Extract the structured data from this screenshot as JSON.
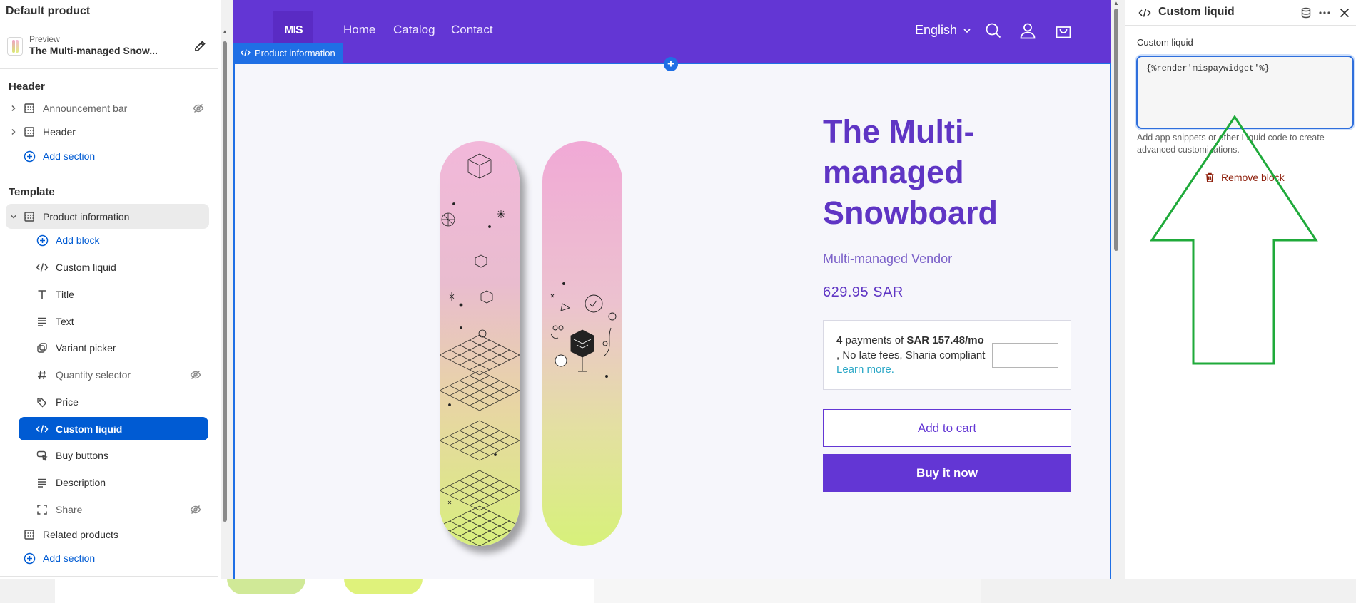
{
  "sidebar": {
    "title": "Default product",
    "preview": {
      "kicker": "Preview",
      "name": "The Multi-managed Snow..."
    },
    "header_group": {
      "heading": "Header",
      "items": [
        {
          "label": "Announcement bar",
          "hidden": true
        },
        {
          "label": "Header",
          "hidden": false
        }
      ],
      "add_section": "Add section"
    },
    "template_group": {
      "heading": "Template",
      "section": "Product information",
      "add_block": "Add block",
      "blocks": [
        {
          "label": "Custom liquid",
          "icon": "code-icon"
        },
        {
          "label": "Title",
          "icon": "text-title-icon"
        },
        {
          "label": "Text",
          "icon": "text-align-icon"
        },
        {
          "label": "Variant picker",
          "icon": "variant-icon"
        },
        {
          "label": "Quantity selector",
          "icon": "hash-icon",
          "hidden": true
        },
        {
          "label": "Price",
          "icon": "price-tag-icon"
        },
        {
          "label": "Custom liquid",
          "icon": "code-icon",
          "active": true
        },
        {
          "label": "Buy buttons",
          "icon": "cursor-icon"
        },
        {
          "label": "Description",
          "icon": "text-align-icon"
        },
        {
          "label": "Share",
          "icon": "share-icon",
          "hidden": true
        }
      ],
      "related": "Related products",
      "add_section": "Add section"
    }
  },
  "store": {
    "logo": "MIS",
    "nav": [
      "Home",
      "Catalog",
      "Contact"
    ],
    "language": "English",
    "section_tag": "Product information",
    "product": {
      "title": "The Multi-managed Snowboard",
      "vendor": "Multi-managed Vendor",
      "price": "629.95 SAR",
      "installments": {
        "count": "4",
        "payments_of": "payments of",
        "amount": "SAR 157.48/mo",
        "terms": ", No late fees, Sharia compliant",
        "link": "Learn more."
      },
      "add_to_cart": "Add to cart",
      "buy_now": "Buy it now"
    }
  },
  "panel": {
    "title": "Custom liquid",
    "field_label": "Custom liquid",
    "code": "{%render'mispaywidget'%}",
    "help": "Add app snippets or other Liquid code to create advanced customizations.",
    "remove": "Remove block"
  },
  "colors": {
    "brand_purple": "#6336d4",
    "editor_blue": "#005bd3",
    "annotation_green": "#1faa3a"
  }
}
